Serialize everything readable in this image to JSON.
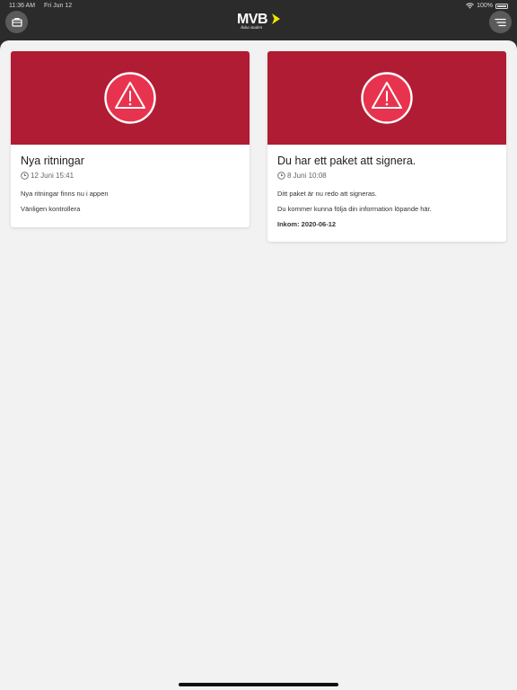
{
  "status_bar": {
    "time": "11:36 AM",
    "date": "Fri Jun 12",
    "battery": "100%"
  },
  "header": {
    "logo_text": "MVB",
    "logo_tagline": "Aska staden",
    "left_icon": "briefcase-icon",
    "right_icon": "menu-icon"
  },
  "colors": {
    "banner": "#b01c33",
    "background": "#f2f2f2",
    "header": "#2b2b2b",
    "logo_accent": "#f2e600"
  },
  "notifications": [
    {
      "title": "Nya ritningar",
      "date": "12 Juni 15:41",
      "lines": [
        "Nya ritningar finns nu i appen",
        "Vänligen kontrollera"
      ],
      "icon": "warning-icon"
    },
    {
      "title": "Du har ett paket att signera.",
      "date": "8 Juni 10:08",
      "lines": [
        "Ditt paket är nu redo att signeras.",
        "Du kommer kunna följa din information löpande här."
      ],
      "received": "Inkom: 2020-06-12",
      "icon": "warning-icon"
    }
  ]
}
